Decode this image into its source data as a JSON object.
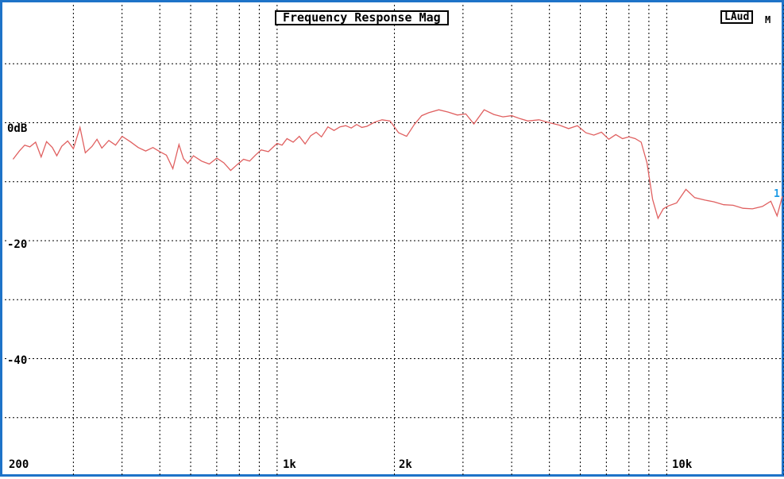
{
  "window": {
    "title": "Frequency Response Mag",
    "trace_label": "LAud",
    "trace_suffix": "M",
    "cursor_label": "1"
  },
  "colors": {
    "border": "#1e73c8",
    "grid": "#000000",
    "trace": "#e06060",
    "cursor": "#1e9be6"
  },
  "chart_data": {
    "type": "line",
    "title": "Frequency Response Mag",
    "xscale": "log",
    "xlim": [
      200,
      20000
    ],
    "ylim": [
      -60,
      20
    ],
    "x_tick_labels": [
      "200",
      "1k",
      "2k",
      "10k"
    ],
    "y_tick_labels": [
      "0dB",
      "-20",
      "-40"
    ],
    "grid": true,
    "series": [
      {
        "name": "LAud",
        "x": [
          210,
          218,
          225,
          232,
          240,
          248,
          256,
          265,
          272,
          280,
          290,
          300,
          312,
          322,
          335,
          345,
          355,
          370,
          385,
          400,
          420,
          440,
          460,
          480,
          500,
          520,
          540,
          560,
          575,
          590,
          610,
          640,
          670,
          700,
          730,
          760,
          790,
          820,
          850,
          880,
          910,
          950,
          1000,
          1030,
          1060,
          1100,
          1140,
          1180,
          1220,
          1260,
          1300,
          1350,
          1400,
          1450,
          1500,
          1550,
          1600,
          1650,
          1700,
          1780,
          1860,
          1950,
          2050,
          2150,
          2250,
          2350,
          2450,
          2600,
          2750,
          2900,
          3050,
          3200,
          3400,
          3600,
          3800,
          4000,
          4200,
          4400,
          4700,
          5000,
          5300,
          5600,
          5900,
          6200,
          6500,
          6800,
          7100,
          7400,
          7700,
          8000,
          8300,
          8600,
          8900,
          9200,
          9500,
          9800,
          10100,
          10600,
          11200,
          11800,
          12500,
          13200,
          14000,
          14800,
          15700,
          16600,
          17600,
          18500,
          19200,
          19800
        ],
        "y": [
          -6.2,
          -4.8,
          -3.8,
          -4.1,
          -3.3,
          -5.8,
          -3.2,
          -4.2,
          -5.6,
          -4.0,
          -3.1,
          -4.4,
          -0.8,
          -5.1,
          -4.0,
          -2.8,
          -4.3,
          -3.0,
          -3.8,
          -2.3,
          -3.2,
          -4.2,
          -4.8,
          -4.2,
          -4.9,
          -5.5,
          -7.8,
          -3.7,
          -6.1,
          -6.9,
          -5.6,
          -6.5,
          -7.0,
          -6.0,
          -6.8,
          -8.1,
          -7.1,
          -6.2,
          -6.5,
          -5.5,
          -4.6,
          -4.9,
          -3.5,
          -3.8,
          -2.7,
          -3.3,
          -2.3,
          -3.6,
          -2.2,
          -1.6,
          -2.4,
          -0.7,
          -1.3,
          -0.7,
          -0.5,
          -0.9,
          -0.3,
          -0.8,
          -0.6,
          0.1,
          0.5,
          0.3,
          -1.7,
          -2.3,
          -0.3,
          1.2,
          1.7,
          2.2,
          1.8,
          1.3,
          1.5,
          -0.2,
          2.2,
          1.4,
          1.0,
          1.2,
          0.7,
          0.3,
          0.5,
          0.0,
          -0.4,
          -1.0,
          -0.5,
          -1.7,
          -2.1,
          -1.6,
          -2.8,
          -2.0,
          -2.7,
          -2.4,
          -2.7,
          -3.3,
          -6.8,
          -13.0,
          -16.2,
          -14.6,
          -14.1,
          -13.6,
          -11.3,
          -12.7,
          -13.1,
          -13.4,
          -13.9,
          -14.0,
          -14.5,
          -14.6,
          -14.2,
          -13.3,
          -15.8,
          -12.5
        ]
      }
    ]
  }
}
